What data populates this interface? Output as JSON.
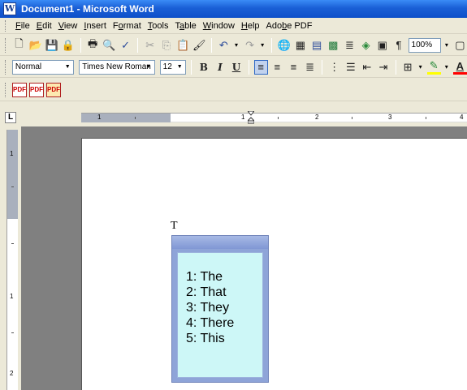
{
  "window": {
    "title": "Document1 - Microsoft Word"
  },
  "menu": [
    {
      "pre": "",
      "u": "F",
      "post": "ile"
    },
    {
      "pre": "",
      "u": "E",
      "post": "dit"
    },
    {
      "pre": "",
      "u": "V",
      "post": "iew"
    },
    {
      "pre": "",
      "u": "I",
      "post": "nsert"
    },
    {
      "pre": "F",
      "u": "o",
      "post": "rmat"
    },
    {
      "pre": "",
      "u": "T",
      "post": "ools"
    },
    {
      "pre": "T",
      "u": "a",
      "post": "ble"
    },
    {
      "pre": "",
      "u": "W",
      "post": "indow"
    },
    {
      "pre": "",
      "u": "H",
      "post": "elp"
    },
    {
      "pre": "Ado",
      "u": "b",
      "post": "e PDF"
    }
  ],
  "standard_toolbar": {
    "zoom": "100%",
    "pilcrow": "¶"
  },
  "formatting_toolbar": {
    "style": "Normal",
    "font": "Times New Roman",
    "size": "12",
    "bold": "B",
    "italic": "I",
    "underline": "U",
    "font_color_glyph": "A"
  },
  "ruler": {
    "h_labels": [
      "1",
      "1",
      "2",
      "3",
      "4"
    ],
    "v_labels": [
      "1",
      "1",
      "2"
    ],
    "tab_selector": "L"
  },
  "document": {
    "typed_text": "T"
  },
  "autocomplete": {
    "items": [
      "1: The",
      "2: That",
      "3: They",
      "4: There",
      "5: This"
    ]
  },
  "colors": {
    "title_bar": "#0d4fc9",
    "popup_list_bg": "#cdf7f7",
    "popup_frame": "#8ea4d8"
  }
}
